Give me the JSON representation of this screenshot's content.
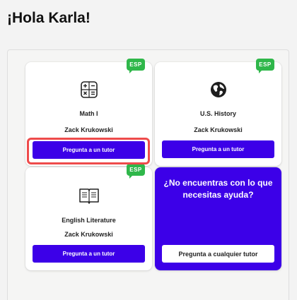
{
  "greeting": "¡Hola Karla!",
  "badge_label": "ESP",
  "courses": [
    {
      "icon": "calculator-icon",
      "subject": "Math I",
      "tutor": "Zack Krukowski",
      "button": "Pregunta a un tutor"
    },
    {
      "icon": "globe-icon",
      "subject": "U.S. History",
      "tutor": "Zack Krukowski",
      "button": "Pregunta a un tutor"
    },
    {
      "icon": "book-icon",
      "subject": "English Literature",
      "tutor": "Zack Krukowski",
      "button": "Pregunta a un tutor"
    }
  ],
  "help_card": {
    "text": "¿No encuentras con lo que necesitas ayuda?",
    "button": "Pregunta a cualquier tutor"
  },
  "colors": {
    "accent": "#3c00e8",
    "badge": "#2fb74a",
    "highlight": "#ee4b4b"
  }
}
